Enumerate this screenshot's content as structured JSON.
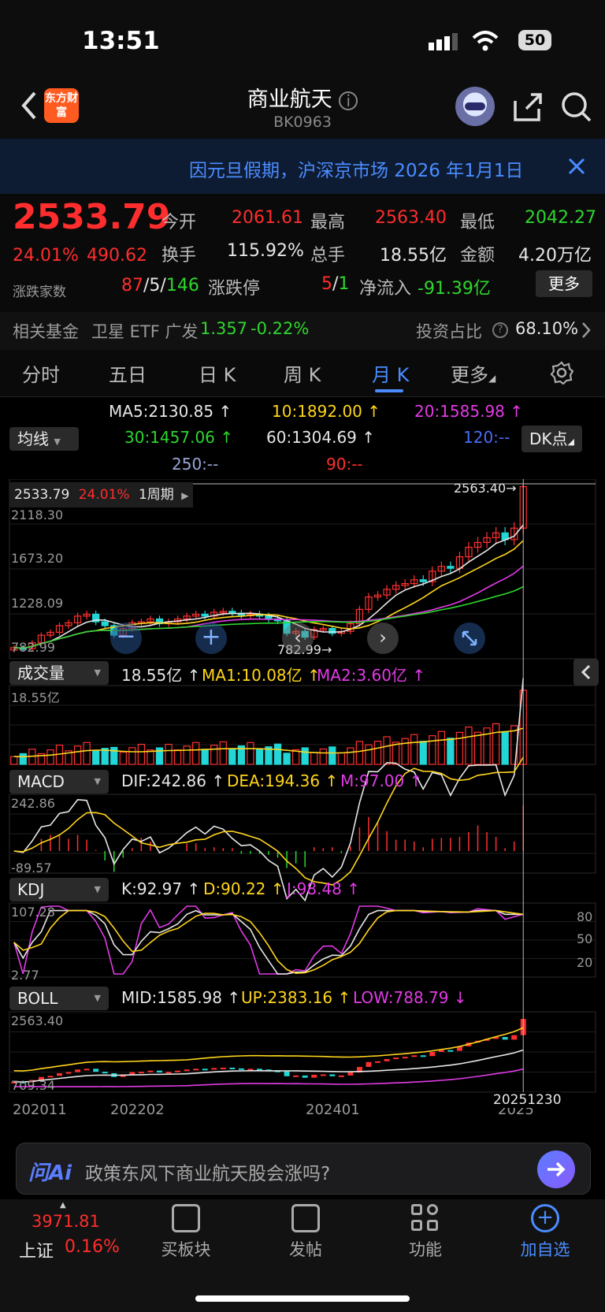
{
  "status": {
    "time": "13:51",
    "battery": "50"
  },
  "header": {
    "title": "商业航天",
    "code": "BK0963",
    "logo": "东方财富"
  },
  "notice": {
    "text": "因元旦假期，沪深京市场 2026 年1月1日"
  },
  "quote": {
    "price": "2533.79",
    "pct": "24.01%",
    "change": "490.62",
    "open_label": "今开",
    "open": "2061.61",
    "high_label": "最高",
    "high": "2563.40",
    "low_label": "最低",
    "low": "2042.27",
    "turnover_label": "换手",
    "turnover": "115.92%",
    "volume_label": "总手",
    "volume": "18.55亿",
    "amount_label": "金额",
    "amount": "4.20万亿",
    "breadth_label": "涨跌家数",
    "up": "87",
    "flat": "5",
    "down": "146",
    "limit_label": "涨跌停",
    "limit_up": "5",
    "limit_down": "1",
    "netflow_label": "净流入",
    "netflow": "-91.39亿",
    "more": "更多"
  },
  "fund": {
    "label": "相关基金",
    "name": "卫星 ETF 广发",
    "price": "1.357",
    "pct": "-0.22%",
    "ratio_label": "投资占比",
    "ratio": "68.10%"
  },
  "tabs": [
    "分时",
    "五日",
    "日 K",
    "周 K",
    "月 K",
    "更多"
  ],
  "ma": {
    "selector": "均线",
    "dk": "DK点",
    "ma5": "MA5:2130.85 ↑",
    "ma10": "10:1892.00 ↑",
    "ma20": "20:1585.98 ↑",
    "ma30": "30:1457.06 ↑",
    "ma60": "60:1304.69 ↑",
    "ma120": "120:--",
    "ma250": "250:--",
    "ma90": "90:--"
  },
  "kline": {
    "price_box": "2533.79",
    "pct_box": "24.01%",
    "period": "1周期",
    "y_labels": [
      "2118.30",
      "1673.20",
      "1228.09",
      "782.99"
    ],
    "max_label": "2563.40→",
    "min_label": "782.99→"
  },
  "vol": {
    "selector": "成交量",
    "v": "18.55亿 ↑",
    "ma1": "MA1:10.08亿 ↑",
    "ma2": "MA2:3.60亿 ↑",
    "axis": "18.55亿"
  },
  "macd": {
    "selector": "MACD",
    "dif": "DIF:242.86 ↑",
    "dea": "DEA:194.36 ↑",
    "m": "M:97.00 ↑",
    "ymax": "242.86",
    "ymin": "-89.57"
  },
  "kdj": {
    "selector": "KDJ",
    "k": "K:92.97 ↑",
    "d": "D:90.22 ↑",
    "j": "J:98.48 ↑",
    "ymax": "107.28",
    "ymin": "2.77",
    "levels": [
      "80",
      "50",
      "20"
    ]
  },
  "boll": {
    "selector": "BOLL",
    "mid": "MID:1585.98 ↑",
    "up": "UP:2383.16 ↑",
    "low": "LOW:788.79 ↓",
    "ymax": "2563.40",
    "ymin": "709.34"
  },
  "x_axis": {
    "labels": [
      "202011",
      "202202",
      "202401",
      "2025"
    ],
    "cursor": "20251230"
  },
  "ai": {
    "brand": "问Ai",
    "prompt": "政策东风下商业航天股会涨吗?"
  },
  "nav": {
    "index_value": "3971.81",
    "index_name": "上证",
    "index_pct": "0.16%",
    "items": [
      "买板块",
      "发帖",
      "功能",
      "加自选"
    ]
  },
  "chart_data": {
    "type": "candlestick",
    "note_series": [
      "close"
    ],
    "close": [
      850,
      840,
      900,
      980,
      1010,
      1080,
      1110,
      1180,
      1200,
      1120,
      1080,
      980,
      1050,
      1110,
      1120,
      1150,
      1100,
      1120,
      1150,
      1180,
      1200,
      1180,
      1220,
      1230,
      1210,
      1190,
      1200,
      1180,
      1150,
      1130,
      1000,
      1020,
      960,
      1040,
      1050,
      1000,
      1020,
      1100,
      1250,
      1380,
      1400,
      1460,
      1500,
      1520,
      1560,
      1540,
      1650,
      1700,
      1680,
      1800,
      1900,
      1950,
      2000,
      2050,
      1980,
      2100,
      2533.79
    ],
    "y_range": [
      782.99,
      2563.4
    ]
  }
}
